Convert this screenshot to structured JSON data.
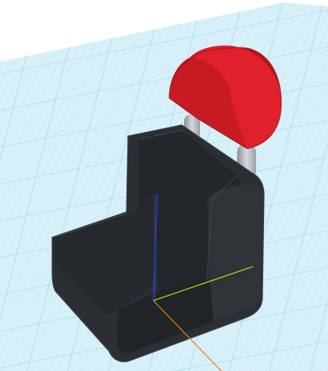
{
  "viewport": {
    "background": "#ffffff",
    "workplane": {
      "fill": "#d8f0f8",
      "minor_grid_color": "#bfe3f1",
      "major_grid_color": "#8fd0ea"
    }
  },
  "model": {
    "body": {
      "name": "seat-body",
      "color": "#2b2f33",
      "shadow_color": "#1e2124",
      "edge_color": "#3a4146"
    },
    "headrest": {
      "name": "headrest",
      "color": "#e0202b",
      "shade_color": "#b4151d",
      "edge_color": "#7a0e12"
    },
    "posts": {
      "name": "headrest-posts",
      "color": "#a9adb1",
      "highlight_color": "#d6d9dc"
    }
  },
  "axes": {
    "x_axis_color": "#f07a12",
    "y_axis_color": "#8fdc10",
    "z_axis_color": "#1f3fff"
  }
}
